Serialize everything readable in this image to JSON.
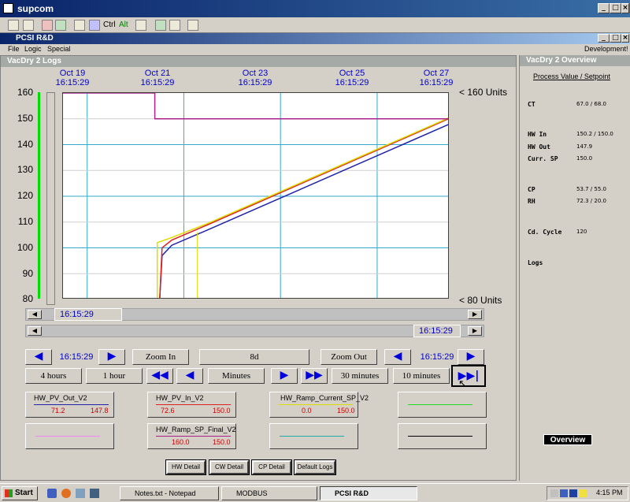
{
  "window": {
    "title": "supcom"
  },
  "toolbar": {
    "ctrl_label": "Ctrl",
    "alt_label": "Alt"
  },
  "app": {
    "title": "PCSI R&D"
  },
  "menu": {
    "file": "File",
    "logic": "Logic",
    "special": "Special",
    "right": "Development!"
  },
  "logs_panel": {
    "title": "VacDry 2 Logs"
  },
  "overview_panel": {
    "title": "VacDry 2 Overview"
  },
  "chart": {
    "date_labels": [
      {
        "date": "Oct 19",
        "time": "16:15:29"
      },
      {
        "date": "Oct 21",
        "time": "16:15:29"
      },
      {
        "date": "Oct 23",
        "time": "16:15:29"
      },
      {
        "date": "Oct 25",
        "time": "16:15:29"
      },
      {
        "date": "Oct 27",
        "time": "16:15:29"
      }
    ],
    "y_ticks": [
      "160",
      "150",
      "140",
      "130",
      "120",
      "110",
      "100",
      "90",
      "80"
    ],
    "upper_limit_label": "< 160 Units",
    "lower_limit_label": "< 80 Units",
    "scroll1_time": "16:15:29",
    "scroll2_time": "16:15:29"
  },
  "chart_data": {
    "type": "line",
    "ylim": [
      80,
      160
    ],
    "x_range": [
      "Oct 18 16:15:29",
      "Oct 26 16:15:29"
    ],
    "x_ticks": [
      "Oct 19 16:15:29",
      "Oct 21 16:15:29",
      "Oct 23 16:15:29",
      "Oct 25 16:15:29",
      "Oct 27 16:15:29"
    ],
    "grid": true,
    "series": [
      {
        "name": "HW_PV_Out_V2",
        "color": "#2222aa",
        "points": [
          [
            0.0,
            null
          ],
          [
            2.0,
            80
          ],
          [
            2.05,
            97
          ],
          [
            2.25,
            101
          ],
          [
            3.0,
            107
          ],
          [
            8.0,
            148
          ]
        ]
      },
      {
        "name": "HW_PV_In_V2",
        "color": "#dd2222",
        "points": [
          [
            2.0,
            80
          ],
          [
            2.05,
            100
          ],
          [
            2.25,
            103
          ],
          [
            3.0,
            109
          ],
          [
            8.0,
            150.2
          ]
        ]
      },
      {
        "name": "HW_Ramp_Current_SP_V2",
        "color": "#dddd00",
        "points": [
          [
            1.95,
            80
          ],
          [
            1.95,
            102
          ],
          [
            2.25,
            104
          ],
          [
            3.0,
            109.5
          ],
          [
            8.0,
            150.5
          ]
        ]
      },
      {
        "name": "HW_Ramp_SP_Final_V2",
        "color": "#aa2288",
        "points": [
          [
            0.0,
            160
          ],
          [
            1.9,
            160
          ],
          [
            1.9,
            150
          ],
          [
            8.0,
            150
          ]
        ]
      }
    ]
  },
  "controls": {
    "left_time": "16:15:29",
    "zoom_in": "Zoom In",
    "span": "8d",
    "zoom_out": "Zoom Out",
    "right_time": "16:15:29",
    "h4": "4 hours",
    "h1": "1 hour",
    "minutes": "Minutes",
    "m30": "30 minutes",
    "m10": "10 minutes",
    "prev": "◀",
    "next": "▶",
    "fast_prev": "◀◀",
    "fast_next": "▶▶",
    "end": "▶▶|"
  },
  "tags": [
    {
      "name": "HW_PV_Out_V2",
      "color": "#2222aa",
      "v1": "71.2",
      "v2": "147.8"
    },
    {
      "name": "HW_PV_In_V2",
      "color": "#dd2222",
      "v1": "72.6",
      "v2": "150.0"
    },
    {
      "name": "HW_Ramp_Current_SP_V2",
      "color": "#dddd00",
      "v1": "0.0",
      "v2": "150.0"
    },
    {
      "name": "",
      "color": "#22dd22",
      "v1": "",
      "v2": ""
    },
    {
      "name": "",
      "color": "#ee88ee",
      "v1": "",
      "v2": ""
    },
    {
      "name": "HW_Ramp_SP_Final_V2",
      "color": "#aa2288",
      "v1": "160.0",
      "v2": "150.0"
    },
    {
      "name": "",
      "color": "#22aaaa",
      "v1": "",
      "v2": ""
    },
    {
      "name": "",
      "color": "#000000",
      "v1": "",
      "v2": ""
    }
  ],
  "bottom_buttons": {
    "hw": "HW Detail",
    "cw": "CW Detail",
    "cp": "CP Detail",
    "def": "Default Logs"
  },
  "overview": {
    "header": "Process Value / Setpoint",
    "ct_l": "CT",
    "ct_v": "67.0  /  68.0",
    "hwin_l": "HW In",
    "hwin_v": "150.2  /  150.0",
    "hwout_l": "HW Out",
    "hwout_v": "147.9",
    "csp_l": "Curr. SP",
    "csp_v": "150.0",
    "cp_l": "CP",
    "cp_v": "53.7  /  55.0",
    "rh_l": "RH",
    "rh_v": "72.3  /  20.0",
    "cd_l": "Cd. Cycle",
    "cd_v": "120",
    "logs_l": "Logs",
    "button": "Overview"
  },
  "taskbar": {
    "start": "Start",
    "t1": "Notes.txt - Notepad",
    "t2": "MODBUS",
    "t3": "PCSI R&D",
    "clock": "4:15 PM"
  }
}
